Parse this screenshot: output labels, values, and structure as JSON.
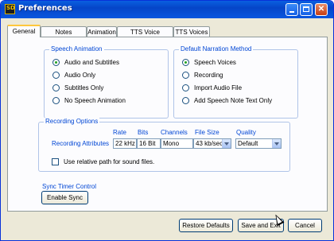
{
  "window": {
    "title": "Preferences",
    "icon": "app-logo-icon"
  },
  "tabs": [
    {
      "label": "General",
      "active": true
    },
    {
      "label": "Notes Publishing",
      "active": false
    },
    {
      "label": "Animation",
      "active": false
    },
    {
      "label": "TTS Voice Schemes",
      "active": false
    },
    {
      "label": "TTS Voices",
      "active": false
    }
  ],
  "speech_animation": {
    "legend": "Speech Animation",
    "options": [
      {
        "label": "Audio and Subtitles",
        "selected": true
      },
      {
        "label": "Audio Only",
        "selected": false
      },
      {
        "label": "Subtitles Only",
        "selected": false
      },
      {
        "label": "No Speech Animation",
        "selected": false
      }
    ]
  },
  "narration": {
    "legend": "Default Narration Method",
    "options": [
      {
        "label": "Speech Voices",
        "selected": true
      },
      {
        "label": "Recording",
        "selected": false
      },
      {
        "label": "Import Audio File",
        "selected": false
      },
      {
        "label": "Add Speech Note Text Only",
        "selected": false
      }
    ]
  },
  "recording": {
    "legend": "Recording Options",
    "headers": {
      "rate": "Rate",
      "bits": "Bits",
      "channels": "Channels",
      "file_size": "File Size",
      "quality": "Quality"
    },
    "row_label": "Recording Attributes",
    "rate": "22 kHz",
    "bits": "16 Bit",
    "channels": "Mono",
    "file_size": "43 kb/sec",
    "quality": "Default",
    "relative_path_label": "Use relative path for sound files.",
    "relative_path_checked": false
  },
  "sync": {
    "label": "Sync Timer Control",
    "button": "Enable Sync"
  },
  "footer": {
    "restore": "Restore Defaults",
    "save_exit": "Save and Exit",
    "cancel": "Cancel"
  },
  "colors": {
    "titlebar": "#0a5fe0",
    "group_legend": "#0046d5",
    "dialog_bg": "#ece9d8"
  }
}
